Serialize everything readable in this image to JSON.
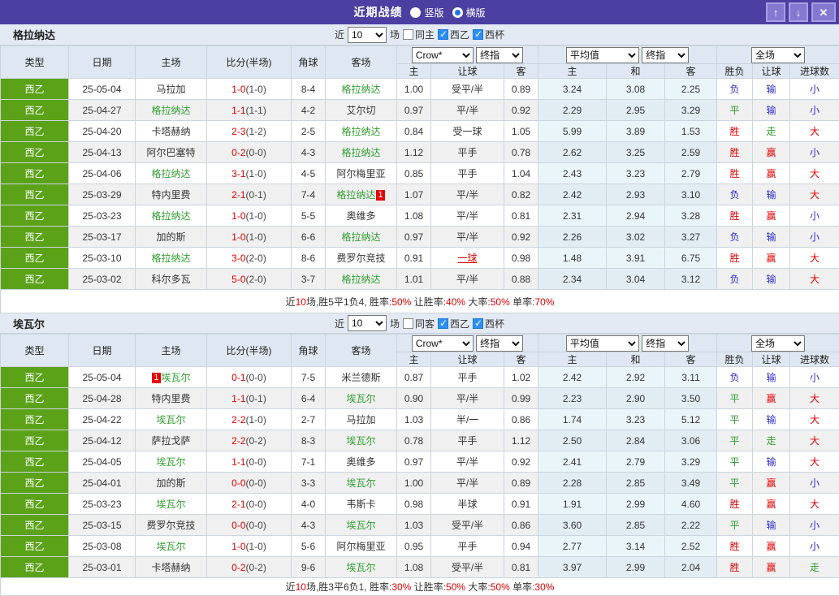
{
  "header": {
    "title": "近期战绩",
    "radio_vertical": "竖版",
    "radio_horizontal": "横版",
    "selected_layout": "横版",
    "window_buttons": {
      "up": "↑",
      "down": "↓",
      "close": "✕"
    }
  },
  "colors": {
    "accent_purple": "#4b3fa2",
    "type_green": "#5ba219",
    "team_green": "#2f9e2f",
    "red": "#e60000",
    "blue": "#2b2bd5",
    "result_map": {
      "胜": "#e60000",
      "负": "#2b2bd5",
      "平": "#2f9e2f",
      "赢": "#e60000",
      "输": "#2b2bd5",
      "走": "#2f9e2f",
      "大": "#e60000",
      "小": "#2b2bd5"
    }
  },
  "columns": {
    "type": "类型",
    "date": "日期",
    "home": "主场",
    "score": "比分(半场)",
    "corner": "角球",
    "away": "客场",
    "sub_home": "主",
    "sub_handicap": "让球",
    "sub_away": "客",
    "sub_home2": "主",
    "sub_draw": "和",
    "sub_away2": "客",
    "wl": "胜负",
    "let_col": "让球",
    "goals": "进球数"
  },
  "dropdowns": {
    "book": "Crow*",
    "final_a": "终指",
    "avg": "平均值",
    "final_b": "终指",
    "scope": "全场"
  },
  "sections": [
    {
      "team": "格拉纳达",
      "filter": {
        "near": "近",
        "games": "10",
        "suffix": "场",
        "same": "同主",
        "same_checked": false,
        "lg1": "西乙",
        "lg1_checked": true,
        "lg2": "西杯",
        "lg2_checked": true
      },
      "rows": [
        {
          "lg": "西乙",
          "date": "25-05-04",
          "home": "马拉加",
          "ft": "1-0",
          "ht": "(1-0)",
          "corner": "8-4",
          "away": "格拉纳达",
          "w1": "1.00",
          "hc": "受平/半",
          "hcRed": false,
          "w2": "0.89",
          "ah": "3.24",
          "ad": "3.08",
          "aa": "2.25",
          "r1": "负",
          "r2": "输",
          "r3": "小"
        },
        {
          "lg": "西乙",
          "date": "25-04-27",
          "home": "格拉纳达",
          "ft": "1-1",
          "ht": "(1-1)",
          "corner": "4-2",
          "away": "艾尔切",
          "w1": "0.97",
          "hc": "平/半",
          "hcRed": false,
          "w2": "0.92",
          "ah": "2.29",
          "ad": "2.95",
          "aa": "3.29",
          "r1": "平",
          "r2": "输",
          "r3": "小"
        },
        {
          "lg": "西乙",
          "date": "25-04-20",
          "home": "卡塔赫纳",
          "ft": "2-3",
          "ht": "(1-2)",
          "corner": "2-5",
          "away": "格拉纳达",
          "w1": "0.84",
          "hc": "受一球",
          "hcRed": false,
          "w2": "1.05",
          "ah": "5.99",
          "ad": "3.89",
          "aa": "1.53",
          "r1": "胜",
          "r2": "走",
          "r3": "大"
        },
        {
          "lg": "西乙",
          "date": "25-04-13",
          "home": "阿尔巴塞特",
          "ft": "0-2",
          "ht": "(0-0)",
          "corner": "4-3",
          "away": "格拉纳达",
          "w1": "1.12",
          "hc": "平手",
          "hcRed": false,
          "w2": "0.78",
          "ah": "2.62",
          "ad": "3.25",
          "aa": "2.59",
          "r1": "胜",
          "r2": "赢",
          "r3": "小"
        },
        {
          "lg": "西乙",
          "date": "25-04-06",
          "home": "格拉纳达",
          "ft": "3-1",
          "ht": "(1-0)",
          "corner": "4-5",
          "away": "阿尔梅里亚",
          "w1": "0.85",
          "hc": "平手",
          "hcRed": false,
          "w2": "1.04",
          "ah": "2.43",
          "ad": "3.23",
          "aa": "2.79",
          "r1": "胜",
          "r2": "赢",
          "r3": "大"
        },
        {
          "lg": "西乙",
          "date": "25-03-29",
          "home": "特内里费",
          "ft": "2-1",
          "ht": "(0-1)",
          "corner": "7-4",
          "away": "格拉纳达",
          "abadge": "1",
          "abpos": "right",
          "w1": "1.07",
          "hc": "平/半",
          "hcRed": false,
          "w2": "0.82",
          "ah": "2.42",
          "ad": "2.93",
          "aa": "3.10",
          "r1": "负",
          "r2": "输",
          "r3": "大"
        },
        {
          "lg": "西乙",
          "date": "25-03-23",
          "home": "格拉纳达",
          "ft": "1-0",
          "ht": "(1-0)",
          "corner": "5-5",
          "away": "奥维多",
          "w1": "1.08",
          "hc": "平/半",
          "hcRed": false,
          "w2": "0.81",
          "ah": "2.31",
          "ad": "2.94",
          "aa": "3.28",
          "r1": "胜",
          "r2": "赢",
          "r3": "小"
        },
        {
          "lg": "西乙",
          "date": "25-03-17",
          "home": "加的斯",
          "ft": "1-0",
          "ht": "(1-0)",
          "corner": "6-6",
          "away": "格拉纳达",
          "w1": "0.97",
          "hc": "平/半",
          "hcRed": false,
          "w2": "0.92",
          "ah": "2.26",
          "ad": "3.02",
          "aa": "3.27",
          "r1": "负",
          "r2": "输",
          "r3": "小"
        },
        {
          "lg": "西乙",
          "date": "25-03-10",
          "home": "格拉纳达",
          "ft": "3-0",
          "ht": "(2-0)",
          "corner": "8-6",
          "away": "费罗尔竞技",
          "w1": "0.91",
          "hc": "一球",
          "hcRed": true,
          "w2": "0.98",
          "ah": "1.48",
          "ad": "3.91",
          "aa": "6.75",
          "r1": "胜",
          "r2": "赢",
          "r3": "大"
        },
        {
          "lg": "西乙",
          "date": "25-03-02",
          "home": "科尔多瓦",
          "ft": "5-0",
          "ht": "(2-0)",
          "corner": "3-7",
          "away": "格拉纳达",
          "w1": "1.01",
          "hc": "平/半",
          "hcRed": false,
          "w2": "0.88",
          "ah": "2.34",
          "ad": "3.04",
          "aa": "3.12",
          "r1": "负",
          "r2": "输",
          "r3": "大"
        }
      ],
      "summary": [
        [
          "近",
          0
        ],
        [
          "10",
          1
        ],
        [
          "场,胜5平1负4, 胜率:",
          0
        ],
        [
          "50%",
          1
        ],
        [
          " 让胜率:",
          0
        ],
        [
          "40%",
          1
        ],
        [
          " 大率:",
          0
        ],
        [
          "50%",
          1
        ],
        [
          " 单率:",
          0
        ],
        [
          "70%",
          1
        ]
      ]
    },
    {
      "team": "埃瓦尔",
      "filter": {
        "near": "近",
        "games": "10",
        "suffix": "场",
        "same": "同客",
        "same_checked": false,
        "lg1": "西乙",
        "lg1_checked": true,
        "lg2": "西杯",
        "lg2_checked": true
      },
      "rows": [
        {
          "lg": "西乙",
          "date": "25-05-04",
          "home": "埃瓦尔",
          "hbadge": "1",
          "hbpos": "left",
          "ft": "0-1",
          "ht": "(0-0)",
          "corner": "7-5",
          "away": "米兰德斯",
          "w1": "0.87",
          "hc": "平手",
          "hcRed": false,
          "w2": "1.02",
          "ah": "2.42",
          "ad": "2.92",
          "aa": "3.11",
          "r1": "负",
          "r2": "输",
          "r3": "小"
        },
        {
          "lg": "西乙",
          "date": "25-04-28",
          "home": "特内里费",
          "ft": "1-1",
          "ht": "(0-1)",
          "corner": "6-4",
          "away": "埃瓦尔",
          "w1": "0.90",
          "hc": "平/半",
          "hcRed": false,
          "w2": "0.99",
          "ah": "2.23",
          "ad": "2.90",
          "aa": "3.50",
          "r1": "平",
          "r2": "赢",
          "r3": "大"
        },
        {
          "lg": "西乙",
          "date": "25-04-22",
          "home": "埃瓦尔",
          "ft": "2-2",
          "ht": "(1-0)",
          "corner": "2-7",
          "away": "马拉加",
          "w1": "1.03",
          "hc": "半/一",
          "hcRed": false,
          "w2": "0.86",
          "ah": "1.74",
          "ad": "3.23",
          "aa": "5.12",
          "r1": "平",
          "r2": "输",
          "r3": "大"
        },
        {
          "lg": "西乙",
          "date": "25-04-12",
          "home": "萨拉戈萨",
          "ft": "2-2",
          "ht": "(0-2)",
          "corner": "8-3",
          "away": "埃瓦尔",
          "w1": "0.78",
          "hc": "平手",
          "hcRed": false,
          "w2": "1.12",
          "ah": "2.50",
          "ad": "2.84",
          "aa": "3.06",
          "r1": "平",
          "r2": "走",
          "r3": "大"
        },
        {
          "lg": "西乙",
          "date": "25-04-05",
          "home": "埃瓦尔",
          "ft": "1-1",
          "ht": "(0-0)",
          "corner": "7-1",
          "away": "奥维多",
          "w1": "0.97",
          "hc": "平/半",
          "hcRed": false,
          "w2": "0.92",
          "ah": "2.41",
          "ad": "2.79",
          "aa": "3.29",
          "r1": "平",
          "r2": "输",
          "r3": "大"
        },
        {
          "lg": "西乙",
          "date": "25-04-01",
          "home": "加的斯",
          "ft": "0-0",
          "ht": "(0-0)",
          "corner": "3-3",
          "away": "埃瓦尔",
          "w1": "1.00",
          "hc": "平/半",
          "hcRed": false,
          "w2": "0.89",
          "ah": "2.28",
          "ad": "2.85",
          "aa": "3.49",
          "r1": "平",
          "r2": "赢",
          "r3": "小"
        },
        {
          "lg": "西乙",
          "date": "25-03-23",
          "home": "埃瓦尔",
          "ft": "2-1",
          "ht": "(0-0)",
          "corner": "4-0",
          "away": "韦斯卡",
          "w1": "0.98",
          "hc": "半球",
          "hcRed": false,
          "w2": "0.91",
          "ah": "1.91",
          "ad": "2.99",
          "aa": "4.60",
          "r1": "胜",
          "r2": "赢",
          "r3": "大"
        },
        {
          "lg": "西乙",
          "date": "25-03-15",
          "home": "费罗尔竞技",
          "ft": "0-0",
          "ht": "(0-0)",
          "corner": "4-3",
          "away": "埃瓦尔",
          "w1": "1.03",
          "hc": "受平/半",
          "hcRed": false,
          "w2": "0.86",
          "ah": "3.60",
          "ad": "2.85",
          "aa": "2.22",
          "r1": "平",
          "r2": "输",
          "r3": "小"
        },
        {
          "lg": "西乙",
          "date": "25-03-08",
          "home": "埃瓦尔",
          "ft": "1-0",
          "ht": "(1-0)",
          "corner": "5-6",
          "away": "阿尔梅里亚",
          "w1": "0.95",
          "hc": "平手",
          "hcRed": false,
          "w2": "0.94",
          "ah": "2.77",
          "ad": "3.14",
          "aa": "2.52",
          "r1": "胜",
          "r2": "赢",
          "r3": "小"
        },
        {
          "lg": "西乙",
          "date": "25-03-01",
          "home": "卡塔赫纳",
          "ft": "0-2",
          "ht": "(0-2)",
          "corner": "9-6",
          "away": "埃瓦尔",
          "w1": "1.08",
          "hc": "受平/半",
          "hcRed": false,
          "w2": "0.81",
          "ah": "3.97",
          "ad": "2.99",
          "aa": "2.04",
          "r1": "胜",
          "r2": "赢",
          "r3": "走"
        }
      ],
      "summary": [
        [
          "近",
          0
        ],
        [
          "10",
          1
        ],
        [
          "场,胜3平6负1, 胜率:",
          0
        ],
        [
          "30%",
          1
        ],
        [
          " 让胜率:",
          0
        ],
        [
          "50%",
          1
        ],
        [
          " 大率:",
          0
        ],
        [
          "50%",
          1
        ],
        [
          " 单率:",
          0
        ],
        [
          "30%",
          1
        ]
      ]
    }
  ]
}
